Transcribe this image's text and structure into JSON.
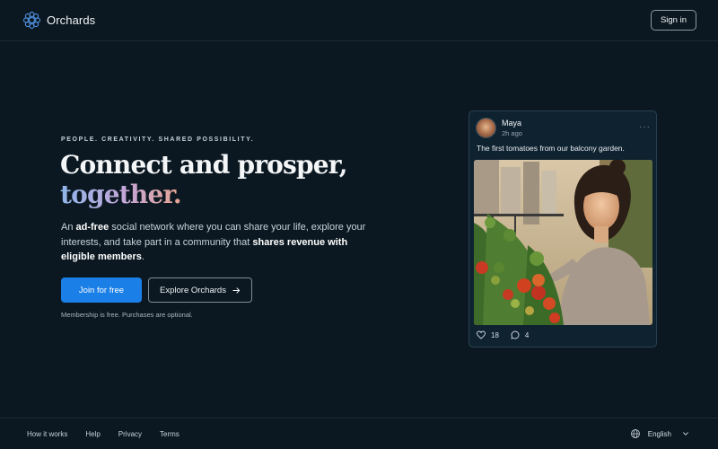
{
  "header": {
    "brand_name": "Orchards",
    "signin_label": "Sign in"
  },
  "hero": {
    "eyebrow": "PEOPLE. CREATIVITY. SHARED POSSIBILITY.",
    "headline_line1": "Connect and prosper,",
    "headline_line2": "together.",
    "description": {
      "p1": "An ",
      "b1": "ad-free",
      "p2": " social network where you can share your life, explore your interests, and take part in a community that ",
      "b2": "shares revenue with eligible members",
      "p3": "."
    },
    "primary_button": "Join for free",
    "secondary_button": "Explore Orchards",
    "note": "Membership is free. Purchases are optional."
  },
  "post": {
    "author": "Maya",
    "time": "2h ago",
    "more": "···",
    "caption": "The first tomatoes from our balcony garden.",
    "likes": "18",
    "comments": "4"
  },
  "footer": {
    "links": [
      "How it works",
      "Help",
      "Privacy",
      "Terms"
    ],
    "language": "English"
  },
  "colors": {
    "background": "#0b1821",
    "accent": "#1a7fe6",
    "card": "#0f2230"
  },
  "icons": {
    "logo": "orchards-logo-icon",
    "arrow": "arrow-right-icon",
    "heart": "heart-icon",
    "comment": "comment-icon",
    "more": "more-icon",
    "globe": "globe-icon",
    "chevron": "chevron-down-icon"
  }
}
